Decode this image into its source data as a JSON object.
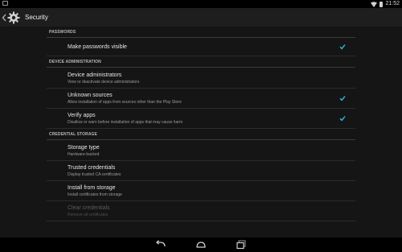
{
  "status_bar": {
    "time": "21:52",
    "icons": [
      "notification-icon",
      "wifi-icon",
      "battery-icon"
    ]
  },
  "action_bar": {
    "title": "Security",
    "icons": [
      "chevron-left-icon",
      "settings-gear-icon"
    ]
  },
  "sections": {
    "passwords": {
      "header": "PASSWORDS"
    },
    "device_admin": {
      "header": "DEVICE ADMINISTRATION"
    },
    "credential_storage": {
      "header": "CREDENTIAL STORAGE"
    }
  },
  "prefs": {
    "make_passwords_visible": {
      "title": "Make passwords visible",
      "checked": true
    },
    "device_administrators": {
      "title": "Device administrators",
      "summary": "View or deactivate device administrators"
    },
    "unknown_sources": {
      "title": "Unknown sources",
      "summary": "Allow installation of apps from sources other than the Play Store",
      "checked": true
    },
    "verify_apps": {
      "title": "Verify apps",
      "summary": "Disallow or warn before installation of apps that may cause harm",
      "checked": true
    },
    "storage_type": {
      "title": "Storage type",
      "summary": "Hardware-backed"
    },
    "trusted_credentials": {
      "title": "Trusted credentials",
      "summary": "Display trusted CA certificates"
    },
    "install_from_storage": {
      "title": "Install from storage",
      "summary": "Install certificates from storage"
    },
    "clear_credentials": {
      "title": "Clear credentials",
      "summary": "Remove all certificates",
      "enabled": false
    }
  },
  "nav_bar": {
    "icons": [
      "back-icon",
      "home-icon",
      "recent-apps-icon"
    ]
  },
  "colors": {
    "accent": "#33b5e5",
    "background": "#151515",
    "action_bar": "#1e1e1e"
  }
}
